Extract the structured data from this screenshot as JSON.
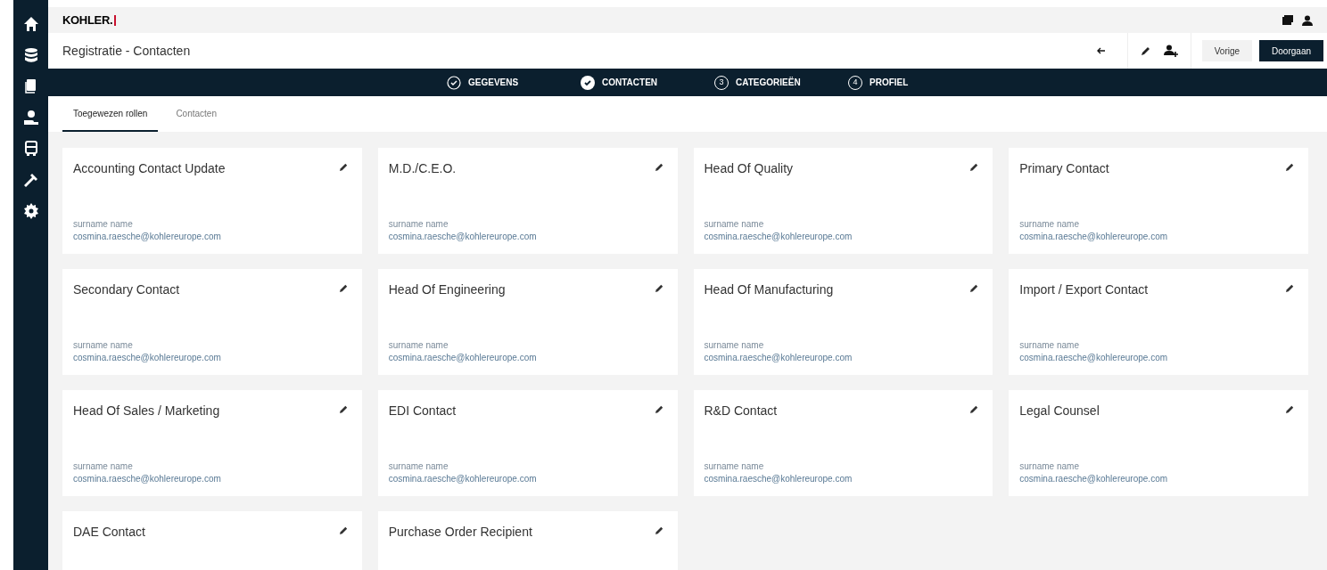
{
  "brand": {
    "logo": "KOHLER."
  },
  "header": {
    "title": "Registratie - Contacten",
    "buttons": [
      {
        "label": "Vorige",
        "kind": "secondary"
      },
      {
        "label": "Doorgaan",
        "kind": "primary"
      }
    ]
  },
  "steps": [
    {
      "label": "GEGEVENS",
      "completed": true,
      "current": false
    },
    {
      "label": "CONTACTEN",
      "completed": true,
      "current": true
    },
    {
      "label": "CATEGORIEËN",
      "completed": false,
      "current": false,
      "number": "3"
    },
    {
      "label": "PROFIEL",
      "completed": false,
      "current": false,
      "number": "4"
    }
  ],
  "tabs": [
    {
      "label": "Toegewezen rollen",
      "selected": true
    },
    {
      "label": "Contacten",
      "selected": false
    }
  ],
  "cards": [
    {
      "role": "Accounting Contact Update",
      "name": "surname name",
      "email": "cosmina.raesche@kohlereurope.com"
    },
    {
      "role": "M.D./C.E.O.",
      "name": "surname name",
      "email": "cosmina.raesche@kohlereurope.com"
    },
    {
      "role": "Head Of Quality",
      "name": "surname name",
      "email": "cosmina.raesche@kohlereurope.com"
    },
    {
      "role": "Primary Contact",
      "name": "surname name",
      "email": "cosmina.raesche@kohlereurope.com"
    },
    {
      "role": "Secondary Contact",
      "name": "surname name",
      "email": "cosmina.raesche@kohlereurope.com"
    },
    {
      "role": "Head Of Engineering",
      "name": "surname name",
      "email": "cosmina.raesche@kohlereurope.com"
    },
    {
      "role": "Head Of Manufacturing",
      "name": "surname name",
      "email": "cosmina.raesche@kohlereurope.com"
    },
    {
      "role": "Import / Export Contact",
      "name": "surname name",
      "email": "cosmina.raesche@kohlereurope.com"
    },
    {
      "role": "Head Of Sales / Marketing",
      "name": "surname name",
      "email": "cosmina.raesche@kohlereurope.com"
    },
    {
      "role": "EDI Contact",
      "name": "surname name",
      "email": "cosmina.raesche@kohlereurope.com"
    },
    {
      "role": "R&D Contact",
      "name": "surname name",
      "email": "cosmina.raesche@kohlereurope.com"
    },
    {
      "role": "Legal Counsel",
      "name": "surname name",
      "email": "cosmina.raesche@kohlereurope.com"
    },
    {
      "role": "DAE Contact"
    },
    {
      "role": "Purchase Order Recipient"
    }
  ]
}
